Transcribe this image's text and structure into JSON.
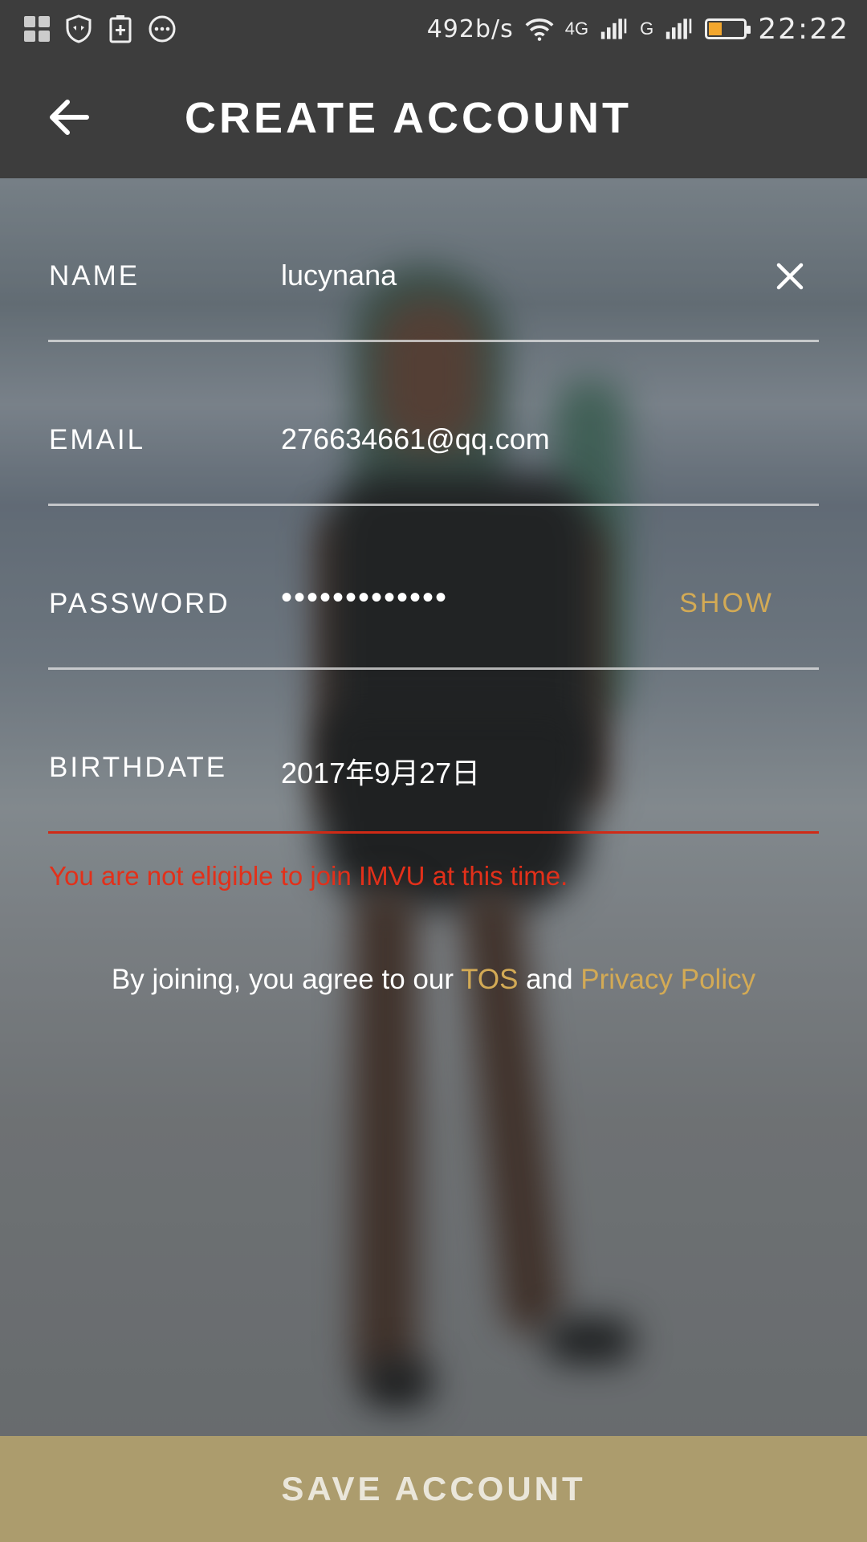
{
  "status_bar": {
    "net_speed": "492b/s",
    "network_4g": "4G",
    "network_g": "G",
    "time": "22:22",
    "battery_percent": 40
  },
  "header": {
    "title": "CREATE ACCOUNT"
  },
  "form": {
    "name": {
      "label": "NAME",
      "value": "lucynana"
    },
    "email": {
      "label": "EMAIL",
      "value": "276634661@qq.com"
    },
    "password": {
      "label": "PASSWORD",
      "value": "•••••••••••••",
      "show_label": "SHOW"
    },
    "birthdate": {
      "label": "BIRTHDATE",
      "value": "2017年9月27日"
    }
  },
  "error_message": "You are not eligible to join IMVU at this time.",
  "terms": {
    "prefix": "By joining, you agree to our ",
    "tos": "TOS",
    "and": " and ",
    "privacy": "Privacy Policy"
  },
  "save_button": "SAVE ACCOUNT",
  "colors": {
    "accent": "#d3aa55",
    "error": "#e2301a",
    "bar": "#3d3d3d",
    "save": "#ac9c6d"
  }
}
